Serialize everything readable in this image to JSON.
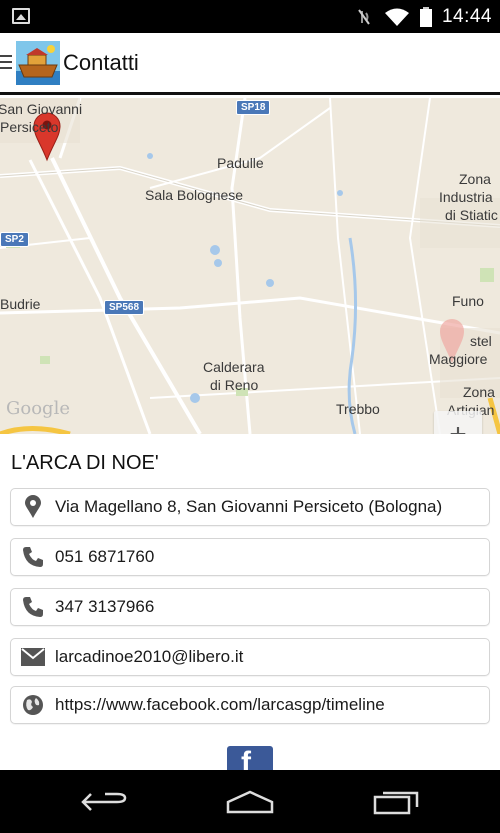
{
  "status_bar": {
    "time": "14:44",
    "icons": [
      "image-icon",
      "mute-icon",
      "wifi-icon",
      "battery-icon"
    ]
  },
  "action_bar": {
    "title": "Contatti",
    "icons": [
      "hamburger-menu-icon",
      "ark-logo-icon"
    ]
  },
  "map": {
    "labels": {
      "san_giovanni_1": "San Giovanni",
      "san_giovanni_2": "Persiceto",
      "padulle": "Padulle",
      "sala": "Sala Bolognese",
      "zona_1": "Zona",
      "zona_2": "Industria",
      "zona_3": "di Stiatic",
      "budrie": "Budrie",
      "funo": "Funo",
      "castel_1": "stel",
      "castel_2": "Maggiore",
      "zona_art_1": "Zona",
      "zona_art_2": "Artigian",
      "calderara_1": "Calderara",
      "calderara_2": "di Reno",
      "trebbo": "Trebbo"
    },
    "roads": {
      "sp18": "SP18",
      "sp2": "SP2",
      "sp568": "SP568"
    },
    "brand": "Google",
    "zoom_in": "+",
    "zoom_out": "−"
  },
  "business": {
    "name": "L'ARCA DI NOE'"
  },
  "contacts": [
    {
      "icon": "location-pin-icon",
      "text": "Via Magellano 8, San Giovanni Persiceto (Bologna)"
    },
    {
      "icon": "phone-icon",
      "text": "051 6871760"
    },
    {
      "icon": "phone-icon",
      "text": "347 3137966"
    },
    {
      "icon": "email-icon",
      "text": "larcadinoe2010@libero.it"
    },
    {
      "icon": "globe-icon",
      "text": "https://www.facebook.com/larcasgp/timeline"
    }
  ],
  "facebook_button": {
    "label": "f"
  },
  "nav_bar": {
    "icons": [
      "back-icon",
      "home-icon",
      "recent-apps-icon"
    ]
  },
  "colors": {
    "facebook_blue": "#3b5998",
    "map_background": "#efe9dd",
    "road_shield": "#4a78b8",
    "marker_red": "#d9372b"
  }
}
